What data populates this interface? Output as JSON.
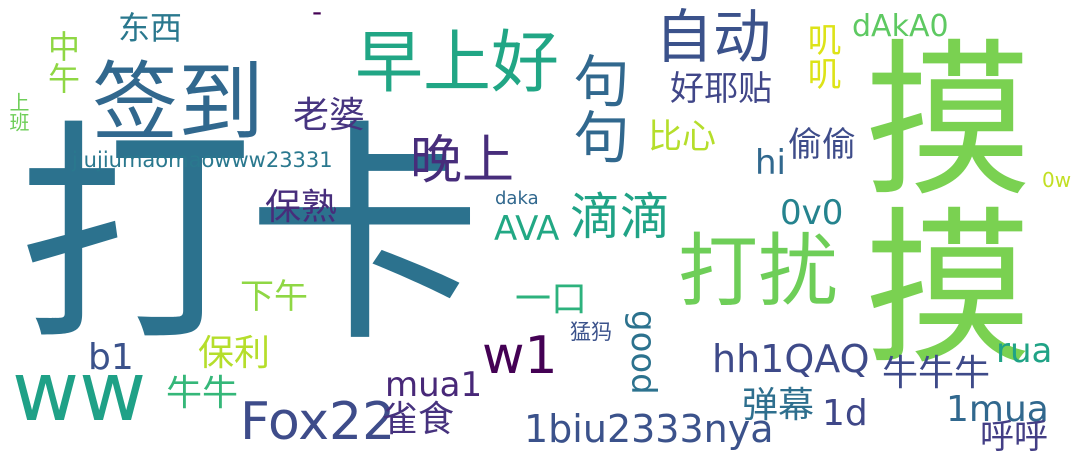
{
  "palette": {
    "teal_dark": "#2c728e",
    "blue_dark": "#31688e",
    "indigo": "#3b528b",
    "purple_dark": "#472d7b",
    "purple_deep": "#440154",
    "green_teal": "#21918c",
    "green_mid": "#1fa187",
    "green_bright": "#35b779",
    "lime_green": "#6ece58",
    "lime": "#7ad151",
    "yellow_green": "#b5de2b",
    "yellow": "#dde318"
  },
  "words": [
    {
      "text": "打卡",
      "color": "#2c728e"
    },
    {
      "text": "摸摸",
      "color": "#7ad151"
    },
    {
      "text": "签到",
      "color": "#31688e"
    },
    {
      "text": "早上好",
      "color": "#21a685"
    },
    {
      "text": "自动",
      "color": "#3b528b"
    },
    {
      "text": "打扰",
      "color": "#6ece58"
    },
    {
      "text": "晚上",
      "color": "#472d7b"
    },
    {
      "text": "滴滴",
      "color": "#20a386"
    },
    {
      "text": "ww",
      "color": "#1fa187"
    },
    {
      "text": "Fox22",
      "color": "#3e4c8a"
    },
    {
      "text": "w1",
      "color": "#440154"
    },
    {
      "text": "1biu2333nya",
      "color": "#3b528b"
    },
    {
      "text": "hh1QAQ",
      "color": "#3e4a89"
    },
    {
      "text": "mua1",
      "color": "#482878"
    },
    {
      "text": "1mua",
      "color": "#31688e"
    },
    {
      "text": "牛牛牛",
      "color": "#3e4a89"
    },
    {
      "text": "弹幕",
      "color": "#2e6f8e"
    },
    {
      "text": "1d",
      "color": "#3f4788"
    },
    {
      "text": "雀食",
      "color": "#46327e"
    },
    {
      "text": "呼呼",
      "color": "#433e85"
    },
    {
      "text": "rua",
      "color": "#20a386"
    },
    {
      "text": "good",
      "color": "#2c728e"
    },
    {
      "text": "一口",
      "color": "#2db27d"
    },
    {
      "text": "保利",
      "color": "#b5de2b"
    },
    {
      "text": "牛牛",
      "color": "#35b779"
    },
    {
      "text": "b1",
      "color": "#3b528b"
    },
    {
      "text": "下午",
      "color": "#8fd744"
    },
    {
      "text": "AVA",
      "color": "#22a884"
    },
    {
      "text": "0v0",
      "color": "#25838e"
    },
    {
      "text": "保熟",
      "color": "#472d7b"
    },
    {
      "text": "老婆",
      "color": "#463480"
    },
    {
      "text": "好耶贴",
      "color": "#404688"
    },
    {
      "text": "比心",
      "color": "#b5de2b"
    },
    {
      "text": "偷偷",
      "color": "#3e4c8a"
    },
    {
      "text": "hi",
      "color": "#31688e"
    },
    {
      "text": "dAkA0",
      "color": "#5ec962"
    },
    {
      "text": "叽叽",
      "color": "#dde318"
    },
    {
      "text": "东西",
      "color": "#2a788e"
    },
    {
      "text": "中午",
      "color": "#8fd744"
    },
    {
      "text": "上班",
      "color": "#6ece58"
    },
    {
      "text": "jiujiumaomaowww23331",
      "color": "#2a788e"
    },
    {
      "text": "daka",
      "color": "#31688e"
    },
    {
      "text": "0w",
      "color": "#c2df23"
    },
    {
      "text": "猛犸",
      "color": "#3b528b"
    },
    {
      "text": "句句",
      "color": "#31688e"
    },
    {
      "text": "-",
      "color": "#440154"
    }
  ]
}
